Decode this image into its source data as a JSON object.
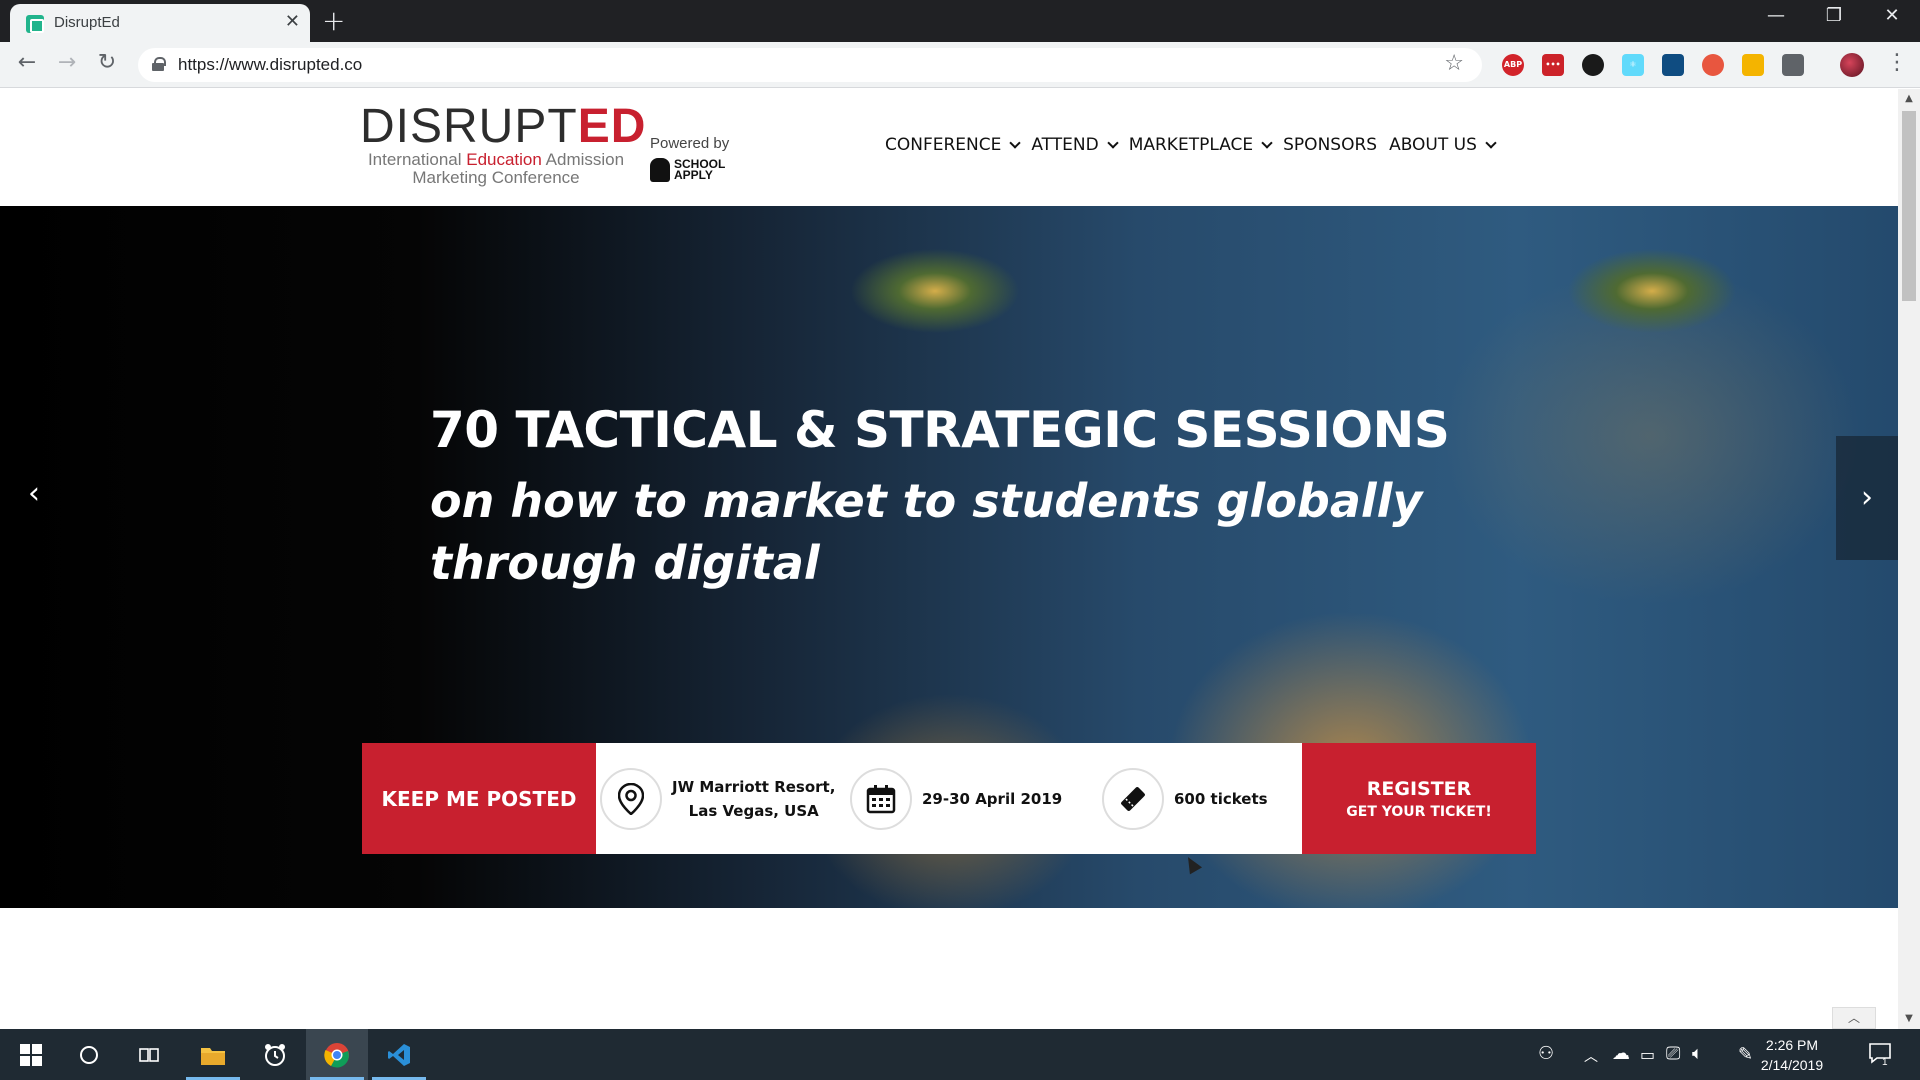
{
  "browser": {
    "tab_title": "DisruptEd",
    "tab_close": "✕",
    "new_tab": "+",
    "url": "https://www.disrupted.co",
    "window": {
      "minimize": "—",
      "restore": "❐",
      "close": "✕"
    },
    "nav": {
      "back": "←",
      "forward": "→",
      "reload": "↻",
      "bookmark": "☆",
      "menu": "⋮"
    },
    "extensions": [
      {
        "name": "adblock-plus-icon",
        "label": "ABP",
        "color": "#d2232a"
      },
      {
        "name": "lastpass-icon",
        "label": "•••",
        "color": "#cc2229"
      },
      {
        "name": "circle-extension-icon",
        "label": "",
        "color": "#1a1a1a"
      },
      {
        "name": "react-devtools-icon",
        "label": "⚛",
        "color": "#61dafb"
      },
      {
        "name": "grid-extension-icon",
        "label": "",
        "color": "#0f4c81"
      },
      {
        "name": "color-picker-icon",
        "label": "",
        "color": "#e8563f"
      },
      {
        "name": "wand-extension-icon",
        "label": "",
        "color": "#f4b400"
      },
      {
        "name": "swirl-extension-icon",
        "label": "",
        "color": "#5f6368"
      }
    ]
  },
  "site": {
    "logo_word_dark": "DISRUPT",
    "logo_word_red": "ED",
    "logo_sub_1a": "International ",
    "logo_sub_1b": "Education",
    "logo_sub_1c": " Admission",
    "logo_sub_2": "Marketing Conference",
    "powered_by": "Powered by",
    "school_apply_1": "SCHOOL",
    "school_apply_2": "APPLY",
    "nav": [
      {
        "label": "CONFERENCE",
        "dropdown": true
      },
      {
        "label": "ATTEND",
        "dropdown": true
      },
      {
        "label": "MARKETPLACE",
        "dropdown": true
      },
      {
        "label": "SPONSORS",
        "dropdown": false
      },
      {
        "label": "ABOUT US",
        "dropdown": true
      }
    ],
    "colors": {
      "brand_red": "#c8202f"
    }
  },
  "hero": {
    "title": "70 TACTICAL & STRATEGIC SESSIONS",
    "subtitle_1": "on how to market to students globally",
    "subtitle_2": "through digital",
    "prev": "‹",
    "next": "›"
  },
  "infobar": {
    "keep_posted": "KEEP ME POSTED",
    "location_1": "JW Marriott Resort,",
    "location_2": "Las Vegas, USA",
    "dates": "29-30 April 2019",
    "tickets": "600 tickets",
    "register": "REGISTER",
    "register_sub": "GET YOUR TICKET!"
  },
  "to_top": "︿",
  "taskbar": {
    "time": "2:26 PM",
    "date": "2/14/2019",
    "notifications": "1"
  }
}
